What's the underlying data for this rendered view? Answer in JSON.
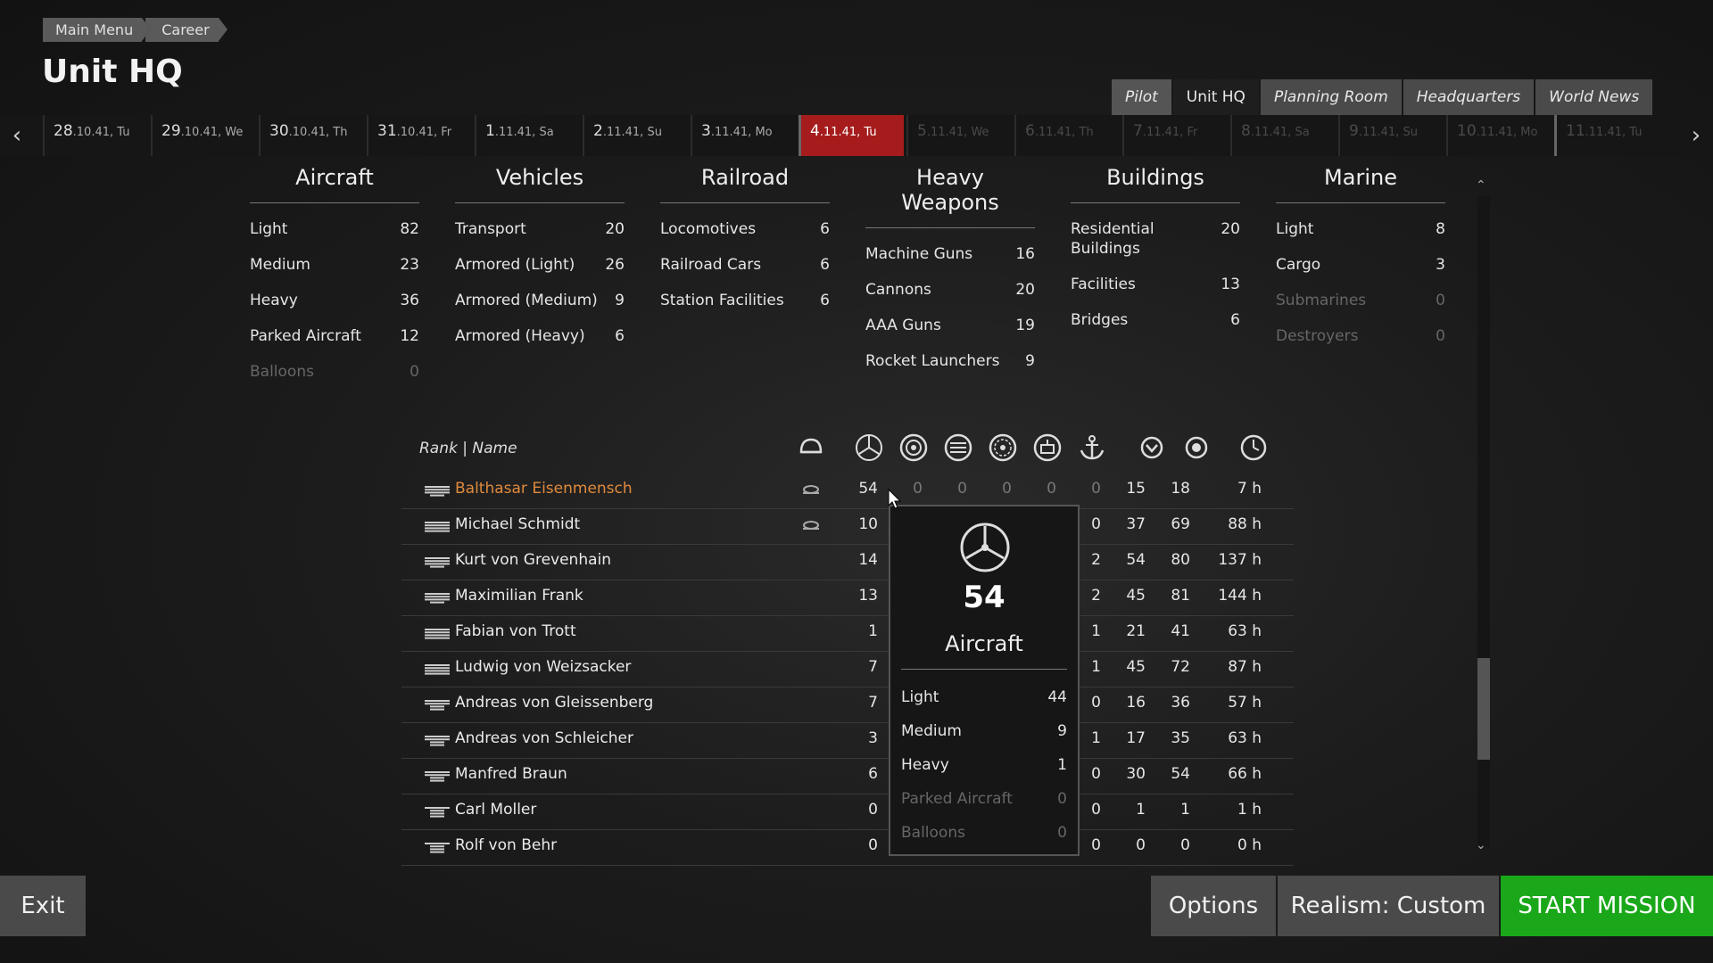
{
  "breadcrumb": [
    "Main Menu",
    "Career"
  ],
  "page_title": "Unit HQ",
  "tabs": [
    "Pilot",
    "Unit HQ",
    "Planning Room",
    "Headquarters",
    "World News"
  ],
  "active_tab": "Unit HQ",
  "calendar": [
    {
      "day": "28",
      "rest": ".10.41, Tu",
      "state": "past"
    },
    {
      "day": "29",
      "rest": ".10.41, We",
      "state": "past"
    },
    {
      "day": "30",
      "rest": ".10.41, Th",
      "state": "past"
    },
    {
      "day": "31",
      "rest": ".10.41, Fr",
      "state": "past"
    },
    {
      "day": "1",
      "rest": ".11.41, Sa",
      "state": "past"
    },
    {
      "day": "2",
      "rest": ".11.41, Su",
      "state": "past"
    },
    {
      "day": "3",
      "rest": ".11.41, Mo",
      "state": "past"
    },
    {
      "day": "4",
      "rest": ".11.41, Tu",
      "state": "current"
    },
    {
      "day": "5",
      "rest": ".11.41, We",
      "state": "future"
    },
    {
      "day": "6",
      "rest": ".11.41, Th",
      "state": "future"
    },
    {
      "day": "7",
      "rest": ".11.41, Fr",
      "state": "future"
    },
    {
      "day": "8",
      "rest": ".11.41, Sa",
      "state": "future"
    },
    {
      "day": "9",
      "rest": ".11.41, Su",
      "state": "future"
    },
    {
      "day": "10",
      "rest": ".11.41, Mo",
      "state": "future"
    },
    {
      "day": "11",
      "rest": ".11.41, Tu",
      "state": "future"
    }
  ],
  "categories": [
    {
      "title": "Aircraft",
      "rows": [
        [
          "Light",
          "82",
          false
        ],
        [
          "Medium",
          "23",
          false
        ],
        [
          "Heavy",
          "36",
          false
        ],
        [
          "Parked Aircraft",
          "12",
          false
        ],
        [
          "Balloons",
          "0",
          true
        ]
      ]
    },
    {
      "title": "Vehicles",
      "rows": [
        [
          "Transport",
          "20",
          false
        ],
        [
          "Armored (Light)",
          "26",
          false
        ],
        [
          "Armored (Medium)",
          "9",
          false
        ],
        [
          "Armored (Heavy)",
          "6",
          false
        ]
      ]
    },
    {
      "title": "Railroad",
      "rows": [
        [
          "Locomotives",
          "6",
          false
        ],
        [
          "Railroad Cars",
          "6",
          false
        ],
        [
          "Station Facilities",
          "6",
          false
        ]
      ]
    },
    {
      "title": "Heavy Weapons",
      "rows": [
        [
          "Machine Guns",
          "16",
          false
        ],
        [
          "Cannons",
          "20",
          false
        ],
        [
          "AAA Guns",
          "19",
          false
        ],
        [
          "Rocket Launchers",
          "9",
          false
        ]
      ]
    },
    {
      "title": "Buildings",
      "rows": [
        [
          "Residential Buildings",
          "20",
          false
        ],
        [
          "Facilities",
          "13",
          false
        ],
        [
          "Bridges",
          "6",
          false
        ]
      ]
    },
    {
      "title": "Marine",
      "rows": [
        [
          "Light",
          "8",
          false
        ],
        [
          "Cargo",
          "3",
          false
        ],
        [
          "Submarines",
          "0",
          true
        ],
        [
          "Destroyers",
          "0",
          true
        ]
      ]
    }
  ],
  "table_header": {
    "rank_name": "Rank | Name"
  },
  "pilots": [
    {
      "name": "Balthasar Eisenmensch",
      "rank": 3,
      "cap": true,
      "highlight": true,
      "v": [
        "54",
        "0",
        "0",
        "0",
        "0",
        "0",
        "15",
        "18",
        "7 h"
      ]
    },
    {
      "name": "Michael Schmidt",
      "rank": 4,
      "cap": true,
      "highlight": false,
      "v": [
        "10",
        "",
        "",
        "",
        "",
        "0",
        "37",
        "69",
        "88 h"
      ]
    },
    {
      "name": "Kurt von Grevenhain",
      "rank": 3,
      "cap": false,
      "highlight": false,
      "v": [
        "14",
        "",
        "",
        "",
        "",
        "2",
        "54",
        "80",
        "137 h"
      ]
    },
    {
      "name": "Maximilian Frank",
      "rank": 3,
      "cap": false,
      "highlight": false,
      "v": [
        "13",
        "",
        "",
        "",
        "",
        "2",
        "45",
        "81",
        "144 h"
      ]
    },
    {
      "name": "Fabian von Trott",
      "rank": 4,
      "cap": false,
      "highlight": false,
      "v": [
        "1",
        "",
        "",
        "",
        "",
        "1",
        "21",
        "41",
        "63 h"
      ]
    },
    {
      "name": "Ludwig von Weizsacker",
      "rank": 4,
      "cap": false,
      "highlight": false,
      "v": [
        "7",
        "",
        "",
        "",
        "",
        "1",
        "45",
        "72",
        "87 h"
      ]
    },
    {
      "name": "Andreas von Gleissenberg",
      "rank": 2,
      "cap": false,
      "highlight": false,
      "v": [
        "7",
        "",
        "",
        "",
        "",
        "0",
        "16",
        "36",
        "57 h"
      ]
    },
    {
      "name": "Andreas von Schleicher",
      "rank": 2,
      "cap": false,
      "highlight": false,
      "v": [
        "3",
        "",
        "",
        "",
        "",
        "1",
        "17",
        "35",
        "63 h"
      ]
    },
    {
      "name": "Manfred Braun",
      "rank": 2,
      "cap": false,
      "highlight": false,
      "v": [
        "6",
        "",
        "",
        "",
        "",
        "0",
        "30",
        "54",
        "66 h"
      ]
    },
    {
      "name": "Carl Moller",
      "rank": 1,
      "cap": false,
      "highlight": false,
      "v": [
        "0",
        "",
        "",
        "",
        "",
        "0",
        "1",
        "1",
        "1 h"
      ]
    },
    {
      "name": "Rolf von Behr",
      "rank": 1,
      "cap": false,
      "highlight": false,
      "v": [
        "0",
        "",
        "",
        "",
        "",
        "0",
        "0",
        "0",
        "0 h"
      ]
    }
  ],
  "header_icons": [
    "helmet-icon",
    "propeller-icon",
    "tank-target-icon",
    "rail-target-icon",
    "gun-target-icon",
    "building-target-icon",
    "anchor-icon",
    "chevron-down-circle-icon",
    "target-icon",
    "clock-icon"
  ],
  "tooltip": {
    "value": "54",
    "title": "Aircraft",
    "rows": [
      [
        "Light",
        "44",
        false
      ],
      [
        "Medium",
        "9",
        false
      ],
      [
        "Heavy",
        "1",
        false
      ],
      [
        "Parked Aircraft",
        "0",
        true
      ],
      [
        "Balloons",
        "0",
        true
      ]
    ]
  },
  "buttons": {
    "exit": "Exit",
    "options": "Options",
    "realism": "Realism: Custom",
    "start": "START MISSION"
  }
}
